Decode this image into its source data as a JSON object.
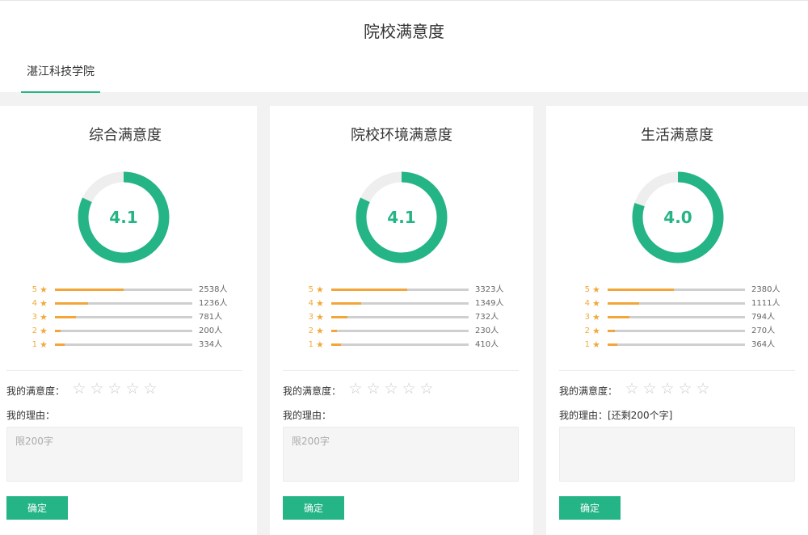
{
  "header": {
    "title": "院校满意度",
    "tab_label": "湛江科技学院"
  },
  "colors": {
    "accent": "#25b486",
    "star": "#f0a93b",
    "bar_fill": "#f2a63a",
    "track": "#cfcfcf"
  },
  "cards": [
    {
      "title": "综合满意度",
      "score": "4.1",
      "score_value": 4.1,
      "distribution": [
        {
          "stars": "5",
          "count": "2538人",
          "fraction": 0.5
        },
        {
          "stars": "4",
          "count": "1236人",
          "fraction": 0.24
        },
        {
          "stars": "3",
          "count": "781人",
          "fraction": 0.15
        },
        {
          "stars": "2",
          "count": "200人",
          "fraction": 0.04
        },
        {
          "stars": "1",
          "count": "334人",
          "fraction": 0.07
        }
      ],
      "my_rating_label": "我的满意度：",
      "my_rating_value": 0,
      "reason_label": "我的理由：",
      "reason_placeholder": "限200字",
      "confirm_label": "确定"
    },
    {
      "title": "院校环境满意度",
      "score": "4.1",
      "score_value": 4.1,
      "distribution": [
        {
          "stars": "5",
          "count": "3323人",
          "fraction": 0.55
        },
        {
          "stars": "4",
          "count": "1349人",
          "fraction": 0.22
        },
        {
          "stars": "3",
          "count": "732人",
          "fraction": 0.12
        },
        {
          "stars": "2",
          "count": "230人",
          "fraction": 0.04
        },
        {
          "stars": "1",
          "count": "410人",
          "fraction": 0.07
        }
      ],
      "my_rating_label": "我的满意度：",
      "my_rating_value": 0,
      "reason_label": "我的理由：",
      "reason_placeholder": "限200字",
      "confirm_label": "确定"
    },
    {
      "title": "生活满意度",
      "score": "4.0",
      "score_value": 4.0,
      "distribution": [
        {
          "stars": "5",
          "count": "2380人",
          "fraction": 0.48
        },
        {
          "stars": "4",
          "count": "1111人",
          "fraction": 0.23
        },
        {
          "stars": "3",
          "count": "794人",
          "fraction": 0.16
        },
        {
          "stars": "2",
          "count": "270人",
          "fraction": 0.05
        },
        {
          "stars": "1",
          "count": "364人",
          "fraction": 0.07
        }
      ],
      "my_rating_label": "我的满意度：",
      "my_rating_value": 0,
      "reason_label": "我的理由：[还剩200个字]",
      "reason_placeholder": "",
      "confirm_label": "确定"
    }
  ]
}
